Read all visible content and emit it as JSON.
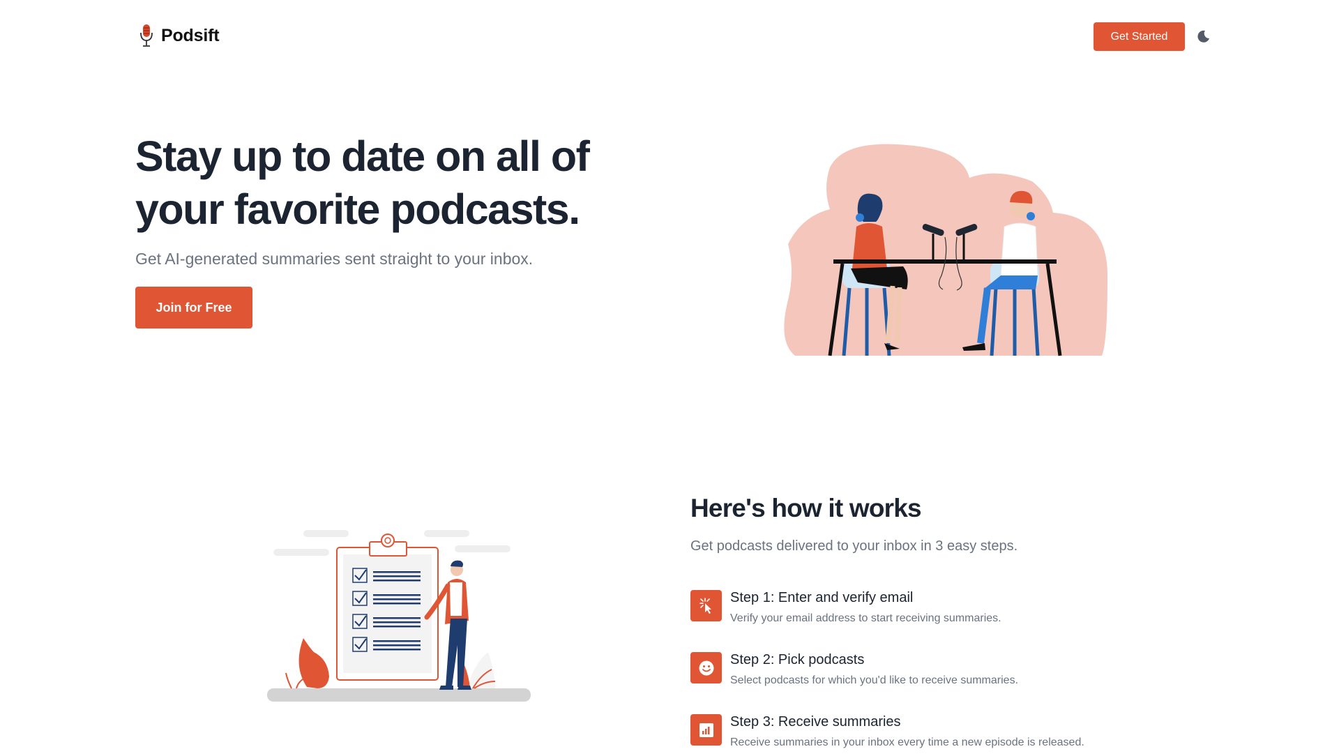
{
  "header": {
    "brand": "Podsift",
    "logo_icon": "microphone-icon",
    "get_started_label": "Get Started",
    "theme_icon": "moon-icon"
  },
  "hero": {
    "title": "Stay up to date on all of your favorite podcasts.",
    "subtitle": "Get AI-generated summaries sent straight to your inbox.",
    "cta_label": "Join for Free",
    "illustration": "podcast-recording-illustration"
  },
  "how_it_works": {
    "title": "Here's how it works",
    "subtitle": "Get podcasts delivered to your inbox in 3 easy steps.",
    "illustration": "checklist-illustration",
    "steps": [
      {
        "title": "Step 1: Enter and verify email",
        "description": "Verify your email address to start receiving summaries.",
        "icon": "cursor-click-icon"
      },
      {
        "title": "Step 2: Pick podcasts",
        "description": "Select podcasts for which you'd like to receive summaries.",
        "icon": "smiley-icon"
      },
      {
        "title": "Step 3: Receive summaries",
        "description": "Receive summaries in your inbox every time a new episode is released.",
        "icon": "bar-chart-icon"
      }
    ]
  },
  "colors": {
    "accent": "#e05533",
    "heading": "#1c2431",
    "muted": "#6b7280",
    "blob": "#f4c6bc"
  }
}
